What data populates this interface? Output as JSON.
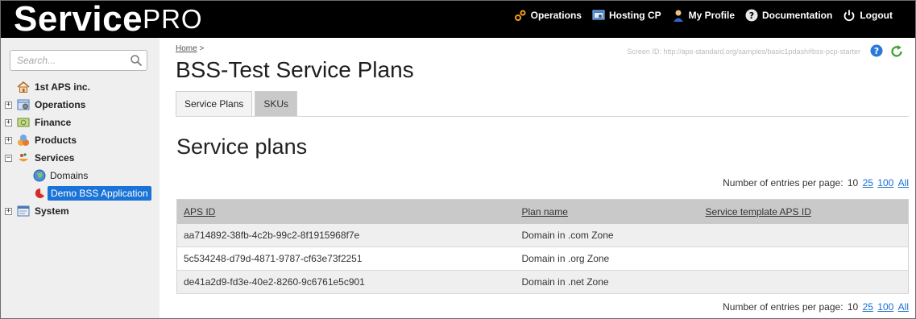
{
  "brand": {
    "part1": "Service",
    "part2": "PRO"
  },
  "topnav": [
    {
      "label": "Operations",
      "icon": "operations-icon"
    },
    {
      "label": "Hosting CP",
      "icon": "hosting-cp-icon"
    },
    {
      "label": "My Profile",
      "icon": "profile-icon"
    },
    {
      "label": "Documentation",
      "icon": "help-icon"
    },
    {
      "label": "Logout",
      "icon": "power-icon"
    }
  ],
  "search": {
    "placeholder": "Search..."
  },
  "tree": {
    "root": "1st APS inc.",
    "items": [
      {
        "label": "Operations",
        "expander": "+"
      },
      {
        "label": "Finance",
        "expander": "+"
      },
      {
        "label": "Products",
        "expander": "+"
      },
      {
        "label": "Services",
        "expander": "−"
      },
      {
        "label": "Domains"
      },
      {
        "label": "Demo BSS Application"
      },
      {
        "label": "System",
        "expander": "+"
      }
    ]
  },
  "breadcrumb": {
    "home": "Home",
    "sep": ">"
  },
  "screen_id": "Screen ID:  http://aps-standard.org/samples/basic1pdash#bss-pcp-starter",
  "page_title": "BSS-Test Service Plans",
  "tabs": [
    {
      "label": "Service Plans",
      "active": true
    },
    {
      "label": "SKUs",
      "active": false
    }
  ],
  "section_title": "Service plans",
  "per_page": {
    "label": "Number of entries per page:",
    "current": "10",
    "options": [
      "25",
      "100",
      "All"
    ]
  },
  "table": {
    "columns": [
      "APS ID",
      "Plan name",
      "Service template APS ID"
    ],
    "rows": [
      [
        "aa714892-38fb-4c2b-99c2-8f1915968f7e",
        "Domain in .com Zone",
        ""
      ],
      [
        "5c534248-d79d-4871-9787-cf63e73f2251",
        "Domain in .org Zone",
        ""
      ],
      [
        "de41a2d9-fd3e-40e2-8260-9c6761e5c901",
        "Domain in .net Zone",
        ""
      ]
    ]
  },
  "colors": {
    "topbar": "#000000",
    "selected": "#1a73d6",
    "link": "#1a6fd1",
    "sidebar": "#efefef"
  }
}
